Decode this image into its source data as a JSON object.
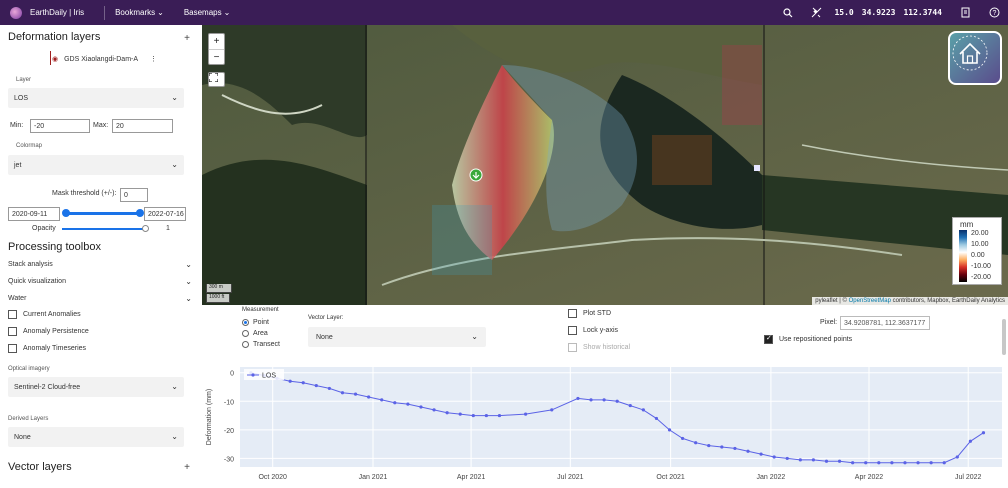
{
  "topbar": {
    "brand": "EarthDaily | Iris",
    "menus": [
      "Bookmarks",
      "Basemaps"
    ],
    "zoom": "15.0",
    "lat": "34.9223",
    "lon": "112.3744"
  },
  "sidebar": {
    "deformation_title": "Deformation layers",
    "layer_name": "GDS Xiaolangdi-Dam-A",
    "layer_label": "Layer",
    "layer_value": "LOS",
    "min_label": "Min:",
    "min_value": "-20",
    "max_label": "Max:",
    "max_value": "20",
    "colormap_label": "Colormap",
    "colormap_value": "jet",
    "mask_label": "Mask threshold (+/-):",
    "mask_value": "0",
    "date_start": "2020-09-11",
    "date_end": "2022-07-16",
    "opacity_label": "Opacity",
    "opacity_value": "1",
    "processing_title": "Processing toolbox",
    "sections": [
      "Stack analysis",
      "Quick visualization",
      "Water"
    ],
    "checks": [
      "Current Anomalies",
      "Anomaly Persistence",
      "Anomaly Timeseries"
    ],
    "optical_label": "Optical imagery",
    "optical_value": "Sentinel-2 Cloud-free",
    "derived_label": "Derived Layers",
    "derived_value": "None",
    "vector_title": "Vector layers"
  },
  "map": {
    "scale_m": "300 m",
    "scale_ft": "1000 ft",
    "attribution_pre": "pyleaflet | © ",
    "attribution_osm": "OpenStreetMap",
    "attribution_post": " contributors, Mapbox, EarthDaily Analytics",
    "colorbar_unit": "mm",
    "colorbar_ticks": [
      "20.00",
      "10.00",
      "0.00",
      "-10.00",
      "-20.00"
    ]
  },
  "controls": {
    "measurement_label": "Measurement",
    "measurement_options": [
      "Point",
      "Area",
      "Transect"
    ],
    "vector_layer_label": "Vector Layer:",
    "vector_layer_value": "None",
    "plot_std": "Plot STD",
    "lock_y": "Lock y-axis",
    "show_historical": "Show historical",
    "pixel_label": "Pixel:",
    "pixel_value": "34.9208781, 112.3637177",
    "use_repositioned": "Use repositioned points"
  },
  "colors": {
    "topbar": "#3a1d56",
    "series": "#5b63e6",
    "plot_bg": "#e5ecf6"
  },
  "chart_data": {
    "type": "line",
    "ylabel": "Deformation (mm)",
    "legend": [
      "LOS"
    ],
    "legend_position": "top-left",
    "ylim": [
      -33,
      2
    ],
    "yticks": [
      0,
      -10,
      -20,
      -30
    ],
    "xlim": [
      "2020-09-01",
      "2022-08-01"
    ],
    "xticks": [
      "2020-10-01",
      "2021-01-01",
      "2021-04-01",
      "2021-07-01",
      "2021-10-01",
      "2022-01-01",
      "2022-04-01",
      "2022-07-01"
    ],
    "xtick_labels": [
      "Oct 2020",
      "Jan 2021",
      "Apr 2021",
      "Jul 2021",
      "Oct 2021",
      "Jan 2022",
      "Apr 2022",
      "Jul 2022"
    ],
    "grid": true,
    "series": [
      {
        "name": "LOS",
        "x": [
          "2020-09-11",
          "2020-09-23",
          "2020-10-05",
          "2020-10-17",
          "2020-10-29",
          "2020-11-10",
          "2020-11-22",
          "2020-12-04",
          "2020-12-16",
          "2020-12-28",
          "2021-01-09",
          "2021-01-21",
          "2021-02-02",
          "2021-02-14",
          "2021-02-26",
          "2021-03-10",
          "2021-03-22",
          "2021-04-03",
          "2021-04-15",
          "2021-04-27",
          "2021-05-21",
          "2021-06-14",
          "2021-07-08",
          "2021-07-20",
          "2021-08-01",
          "2021-08-13",
          "2021-08-25",
          "2021-09-06",
          "2021-09-18",
          "2021-09-30",
          "2021-10-12",
          "2021-10-24",
          "2021-11-05",
          "2021-11-17",
          "2021-11-29",
          "2021-12-11",
          "2021-12-23",
          "2022-01-04",
          "2022-01-16",
          "2022-01-28",
          "2022-02-09",
          "2022-02-21",
          "2022-03-05",
          "2022-03-17",
          "2022-03-29",
          "2022-04-10",
          "2022-04-22",
          "2022-05-04",
          "2022-05-16",
          "2022-05-28",
          "2022-06-09",
          "2022-06-21",
          "2022-07-03",
          "2022-07-15"
        ],
        "values": [
          0,
          -1,
          -2,
          -3,
          -3.5,
          -4.5,
          -5.5,
          -7,
          -7.5,
          -8.5,
          -9.5,
          -10.5,
          -11,
          -12,
          -13,
          -14,
          -14.5,
          -15,
          -15,
          -15,
          -14.5,
          -13,
          -9,
          -9.5,
          -9.5,
          -10,
          -11.5,
          -13,
          -16,
          -20,
          -23,
          -24.5,
          -25.5,
          -26,
          -26.5,
          -27.5,
          -28.5,
          -29.5,
          -30,
          -30.5,
          -30.5,
          -31,
          -31,
          -31.5,
          -31.5,
          -31.5,
          -31.5,
          -31.5,
          -31.5,
          -31.5,
          -31.5,
          -29.5,
          -24,
          -21
        ]
      }
    ]
  }
}
